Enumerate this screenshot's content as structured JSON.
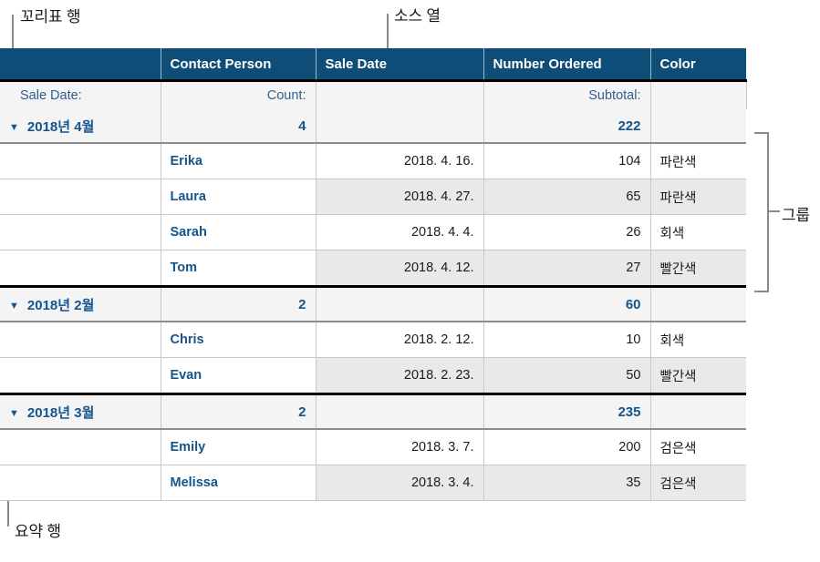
{
  "annotations": [
    {
      "id": "footer-row",
      "label": "꼬리표 행"
    },
    {
      "id": "source-column",
      "label": "소스 열"
    },
    {
      "id": "group",
      "label": "그룹"
    },
    {
      "id": "summary-row",
      "label": "요약 행"
    }
  ],
  "table": {
    "headers": [
      "",
      "Contact Person",
      "Sale Date",
      "Number Ordered",
      "Color"
    ],
    "label_row": {
      "category": "Sale Date:",
      "count": "Count:",
      "date": "",
      "subtotal": "Subtotal:",
      "color": ""
    },
    "disclosure_glyph": "▼",
    "groups": [
      {
        "name": "2018년 4월",
        "count": "4",
        "subtotal": "222",
        "rows": [
          {
            "person": "Erika",
            "date": "2018. 4. 16.",
            "qty": "104",
            "color": "파란색"
          },
          {
            "person": "Laura",
            "date": "2018. 4. 27.",
            "qty": "65",
            "color": "파란색"
          },
          {
            "person": "Sarah",
            "date": "2018. 4. 4.",
            "qty": "26",
            "color": "회색"
          },
          {
            "person": "Tom",
            "date": "2018. 4. 12.",
            "qty": "27",
            "color": "빨간색"
          }
        ]
      },
      {
        "name": "2018년 2월",
        "count": "2",
        "subtotal": "60",
        "rows": [
          {
            "person": "Chris",
            "date": "2018. 2. 12.",
            "qty": "10",
            "color": "회색"
          },
          {
            "person": "Evan",
            "date": "2018. 2. 23.",
            "qty": "50",
            "color": "빨간색"
          }
        ]
      },
      {
        "name": "2018년 3월",
        "count": "2",
        "subtotal": "235",
        "rows": [
          {
            "person": "Emily",
            "date": "2018. 3. 7.",
            "qty": "200",
            "color": "검은색"
          },
          {
            "person": "Melissa",
            "date": "2018. 3. 4.",
            "qty": "35",
            "color": "검은색"
          }
        ]
      }
    ]
  },
  "colors": {
    "header_blue": "#0e4d78",
    "accent_text": "#14558c",
    "tag_text": "#2f6090",
    "row_alt": "#e9e9e9",
    "summary_bg": "#f4f4f4",
    "leader": "#8a8a8a"
  }
}
